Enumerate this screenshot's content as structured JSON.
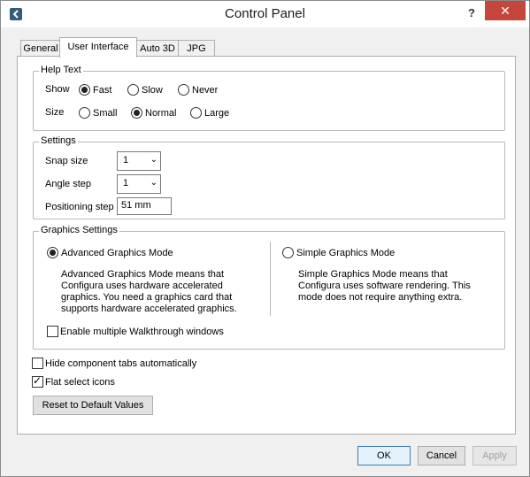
{
  "window": {
    "title": "Control Panel",
    "help_glyph": "?",
    "close_glyph": "✕"
  },
  "tabs": [
    {
      "label": "General",
      "active": false
    },
    {
      "label": "User Interface",
      "active": true
    },
    {
      "label": "Auto 3D",
      "active": false
    },
    {
      "label": "JPG",
      "active": false
    }
  ],
  "help_text": {
    "title": "Help Text",
    "show_label": "Show",
    "show_options": [
      "Fast",
      "Slow",
      "Never"
    ],
    "show_selected": "Fast",
    "size_label": "Size",
    "size_options": [
      "Small",
      "Normal",
      "Large"
    ],
    "size_selected": "Normal"
  },
  "settings": {
    "title": "Settings",
    "snap_size_label": "Snap size",
    "snap_size_value": "1",
    "angle_step_label": "Angle step",
    "angle_step_value": "1",
    "positioning_step_label": "Positioning step",
    "positioning_step_value": "51 mm"
  },
  "graphics": {
    "title": "Graphics Settings",
    "advanced_label": "Advanced Graphics Mode",
    "advanced_desc": [
      "Advanced Graphics Mode means that",
      "Configura uses hardware accelerated",
      "graphics. You need a graphics card that",
      "supports hardware accelerated graphics."
    ],
    "simple_label": "Simple Graphics Mode",
    "simple_desc": [
      "Simple Graphics Mode means that",
      "Configura uses software rendering. This",
      "mode does not require anything extra."
    ],
    "selected": "Advanced Graphics Mode",
    "walkthrough_label": "Enable multiple Walkthrough windows",
    "walkthrough_checked": false
  },
  "options": {
    "hide_tabs_label": "Hide component tabs automatically",
    "hide_tabs_checked": false,
    "flat_icons_label": "Flat select icons",
    "flat_icons_checked": true,
    "reset_label": "Reset to Default Values"
  },
  "footer": {
    "ok_label": "OK",
    "cancel_label": "Cancel",
    "apply_label": "Apply"
  },
  "glyphs": {
    "dropdown": "⌄",
    "checkmark": "✓"
  },
  "colors": {
    "close_button": "#c7463b",
    "default_button_border": "#3c7fb1",
    "app_icon": "#2f5d7c"
  }
}
